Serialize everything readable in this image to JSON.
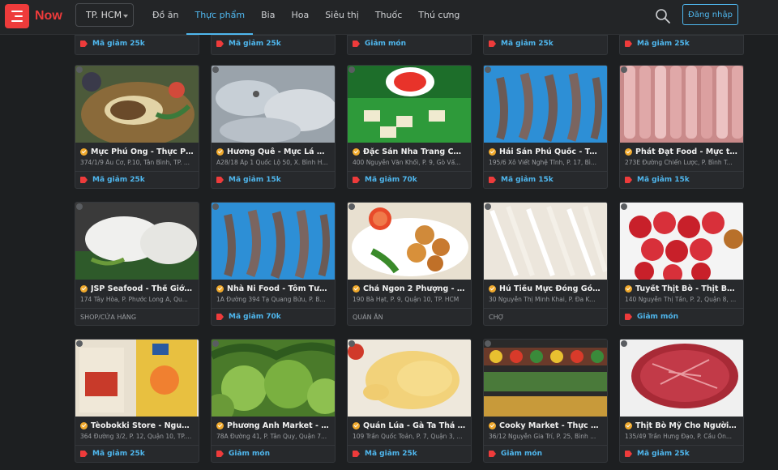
{
  "header": {
    "brand": "Now",
    "city": "TP. HCM",
    "nav": [
      "Đồ ăn",
      "Thực phẩm",
      "Bia",
      "Hoa",
      "Siêu thị",
      "Thuốc",
      "Thú cưng"
    ],
    "active_nav": "Thực phẩm",
    "login": "Đăng nhập"
  },
  "top_row": [
    "Mã giảm 25k",
    "Mã giảm 25k",
    "Giảm món",
    "Mã giảm 25k",
    "Mã giảm 25k"
  ],
  "cards": [
    {
      "title": "Mực Phú Ông - Thực Ph...",
      "addr": "374/1/9 Âu Cơ, P.10, Tân Bình, TP. ...",
      "footer": "Mã giảm 25k",
      "footer_type": "promo",
      "thumb": "squid-dish"
    },
    {
      "title": "Hương Quê - Mực Lá & ...",
      "addr": "A28/18 Ấp 1 Quốc Lộ 50, X. Bình H...",
      "footer": "Mã giảm 15k",
      "footer_type": "promo",
      "thumb": "squid-raw"
    },
    {
      "title": "Đặc Sản Nha Trang Chả ...",
      "addr": "400 Nguyễn Văn Khối, P. 9, Gò Vấ...",
      "footer": "Mã giảm 70k",
      "footer_type": "promo",
      "thumb": "fish-cake"
    },
    {
      "title": "Hải Sản Phú Quốc - Tôm ...",
      "addr": "195/6 Xô Viết Nghệ Tĩnh, P. 17, Bì...",
      "footer": "Mã giảm 15k",
      "footer_type": "promo",
      "thumb": "shrimp"
    },
    {
      "title": "Phát Đạt Food - Mực tư...",
      "addr": "273E Đường Chiến Lược, P. Bình T...",
      "footer": "Mã giảm 15k",
      "footer_type": "promo",
      "thumb": "squid-pink"
    },
    {
      "title": "JSP Seafood - Thế Giới M...",
      "addr": "174 Tây Hòa, P. Phước Long A, Qu...",
      "footer": "SHOP/CỬA HÀNG",
      "footer_type": "cat",
      "thumb": "squid-white"
    },
    {
      "title": "Nhà Ni Food - Tôm Tươi ...",
      "addr": "1A Đường 394 Tạ Quang Bửu, P. B...",
      "footer": "Mã giảm 70k",
      "footer_type": "promo",
      "thumb": "shrimp"
    },
    {
      "title": "Chả Ngon 2 Phượng - Ch...",
      "addr": "190 Bà Hạt, P. 9, Quận 10, TP. HCM",
      "footer": "QUÁN ĂN",
      "footer_type": "cat",
      "thumb": "fried"
    },
    {
      "title": "Hủ Tiếu Mực Đóng Gói - ...",
      "addr": "30 Nguyễn Thị Minh Khai, P. Đa K...",
      "footer": "CHỢ",
      "footer_type": "cat",
      "thumb": "noodle"
    },
    {
      "title": "Tuyết Thịt Bò - Thịt Bò N...",
      "addr": "140 Nguyễn Thị Tần, P. 2, Quận 8, ...",
      "footer": "Giảm món",
      "footer_type": "promo",
      "thumb": "beef-rolls"
    },
    {
      "title": "Tèobokki Store - Nguyê...",
      "addr": "364 Đường 3/2, P. 12, Quận 10, TP....",
      "footer": "Mã giảm 25k",
      "footer_type": "promo",
      "thumb": "snacks"
    },
    {
      "title": "Phương Anh Market - Đ...",
      "addr": "78A Đường 41, P. Tân Quy, Quận 7...",
      "footer": "Giảm món",
      "footer_type": "promo",
      "thumb": "fruit"
    },
    {
      "title": "Quán Lúa - Gà Ta Thả Vư...",
      "addr": "109 Trần Quốc Toản, P. 7, Quận 3, ...",
      "footer": "Mã giảm 25k",
      "footer_type": "promo",
      "thumb": "chicken"
    },
    {
      "title": "Cooky Market - Thực Ph...",
      "addr": "36/12 Nguyễn Gia Trí, P. 25, Bình ...",
      "footer": "Giảm món",
      "footer_type": "promo",
      "thumb": "market"
    },
    {
      "title": "Thịt Bò Mỹ Cho Người S...",
      "addr": "135/49 Trần Hưng Đạo, P. Cầu Ôn...",
      "footer": "Mã giảm 25k",
      "footer_type": "promo",
      "thumb": "steak"
    }
  ],
  "colors": {
    "accent": "#4fb7ee",
    "brand": "#ee3b3b",
    "bg": "#1d1f21",
    "card": "#27292c"
  }
}
